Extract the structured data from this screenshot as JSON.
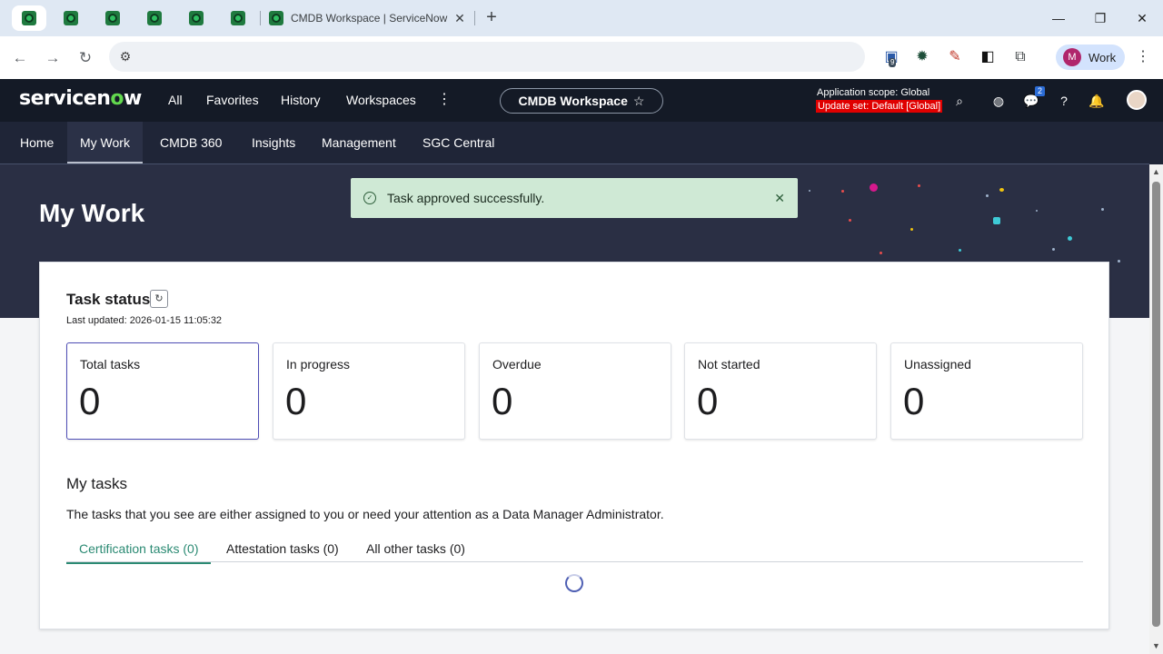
{
  "browser": {
    "tab_title": "CMDB Workspace | ServiceNow",
    "tab_close": "✕",
    "new_tab": "+",
    "profile_initial": "M",
    "profile_label": "Work",
    "extension_badge": "9",
    "window_controls": {
      "minimize": "—",
      "maximize": "❐",
      "close": "✕"
    }
  },
  "header": {
    "nav": [
      "All",
      "Favorites",
      "History",
      "Workspaces"
    ],
    "more": "⋮",
    "workspace_pill": "CMDB Workspace",
    "star": "☆",
    "app_scope": "Application scope: Global",
    "update_set": "Update set: Default [Global]",
    "chat_badge": "2"
  },
  "subnav": {
    "items": [
      "Home",
      "My Work",
      "CMDB 360",
      "Insights",
      "Management",
      "SGC Central"
    ],
    "active": "My Work"
  },
  "page": {
    "title": "My Work"
  },
  "toast": {
    "message": "Task approved successfully.",
    "close": "✕"
  },
  "task_status": {
    "title": "Task status",
    "last_updated": "Last updated: 2026-01-15 11:05:32",
    "stats": [
      {
        "label": "Total tasks",
        "value": "0"
      },
      {
        "label": "In progress",
        "value": "0"
      },
      {
        "label": "Overdue",
        "value": "0"
      },
      {
        "label": "Not started",
        "value": "0"
      },
      {
        "label": "Unassigned",
        "value": "0"
      }
    ]
  },
  "my_tasks": {
    "title": "My tasks",
    "description": "The tasks that you see are either assigned to you or need your attention as a Data Manager Administrator.",
    "tabs": [
      "Certification tasks (0)",
      "Attestation tasks (0)",
      "All other tasks (0)"
    ]
  },
  "colors": {
    "header_bg": "#141a26",
    "subnav_bg": "#1f2537",
    "hero_bg": "#2a2f44",
    "toast_bg": "#cfe9d5",
    "accent_tab": "#2b8a73",
    "selected_card_border": "#4e4db5",
    "update_set_bg": "#e00000"
  },
  "icons": [
    "servicenow-favicon",
    "back-icon",
    "forward-icon",
    "reload-icon",
    "site-settings-icon",
    "extension-icon",
    "pen-icon",
    "puzzle-icon",
    "search-icon",
    "globe-icon",
    "chat-icon",
    "help-icon",
    "bell-icon",
    "user-avatar",
    "refresh-icon",
    "check-circle-icon",
    "close-icon",
    "spinner"
  ]
}
